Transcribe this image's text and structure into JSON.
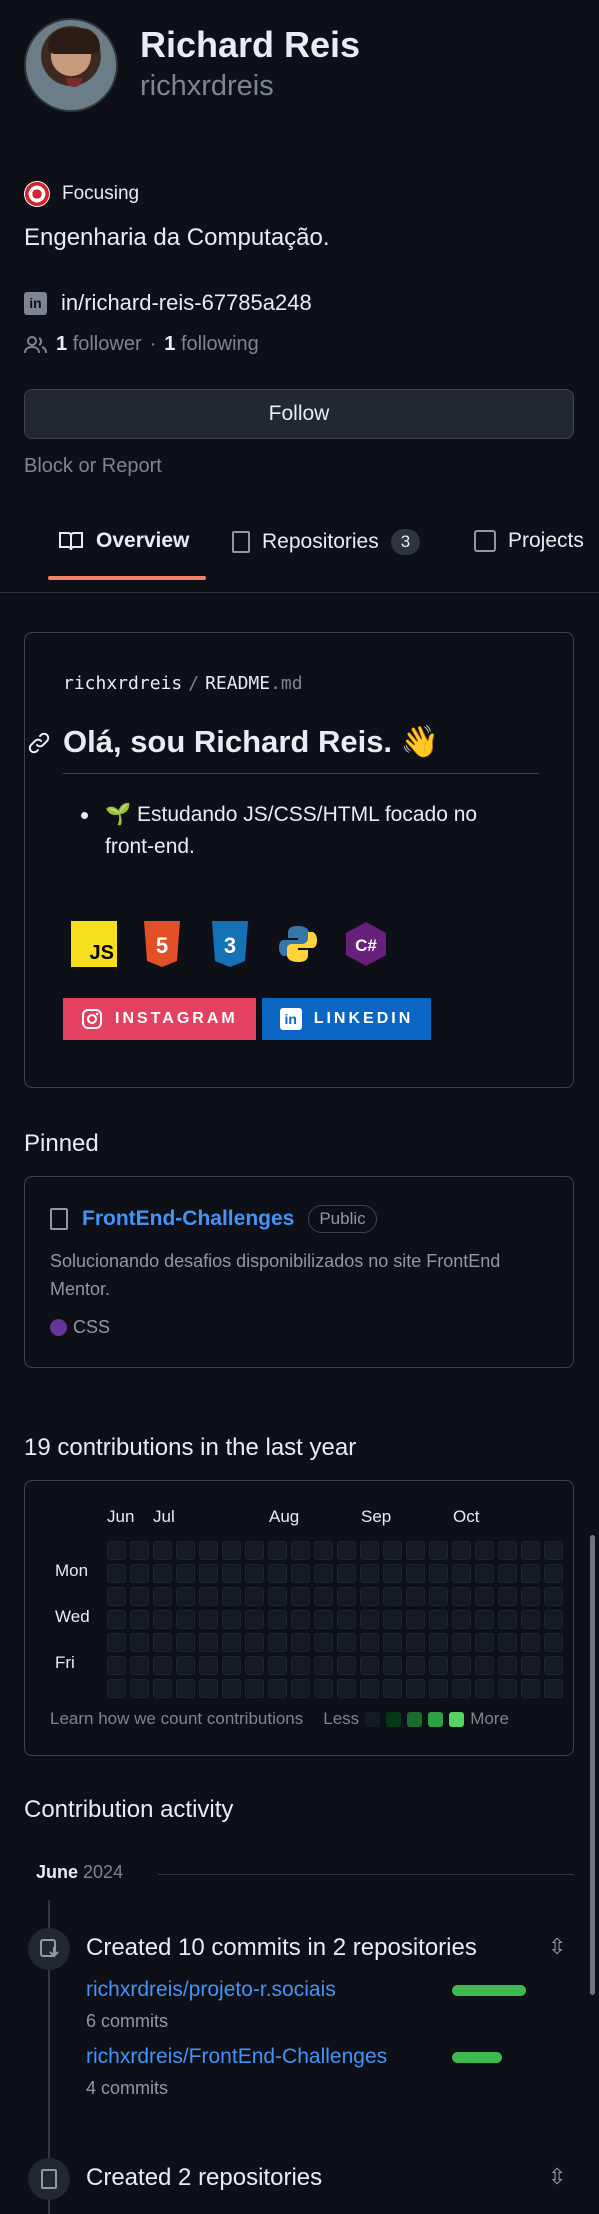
{
  "profile": {
    "name": "Richard Reis",
    "login": "richxrdreis",
    "status": "Focusing",
    "bio": "Engenharia da Computação.",
    "linkedin": "in/richard-reis-67785a248",
    "followers_count": "1",
    "followers_label": "follower",
    "separator": "·",
    "following_count": "1",
    "following_label": "following",
    "follow_button": "Follow",
    "block_report": "Block or Report"
  },
  "tabs": [
    {
      "label": "Overview",
      "active": true,
      "icon": "book-icon"
    },
    {
      "label": "Repositories",
      "count": "3",
      "icon": "repo-icon"
    },
    {
      "label": "Projects",
      "icon": "table-icon"
    }
  ],
  "readme": {
    "owner": "richxrdreis",
    "slash": "/",
    "file": "README",
    "ext": ".md",
    "heading": "Olá, sou Richard Reis. 👋",
    "bullet_emoji": "🌱",
    "bullet": "Estudando JS/CSS/HTML focado no front-end.",
    "tech_icons": [
      {
        "name": "javascript-icon",
        "label": "JS",
        "color": "#f7df1e"
      },
      {
        "name": "html5-icon",
        "label": "5",
        "color": "#e34f26"
      },
      {
        "name": "css3-icon",
        "label": "3",
        "color": "#1572b6"
      },
      {
        "name": "python-icon",
        "label": "",
        "color": "#3776ab"
      },
      {
        "name": "csharp-icon",
        "label": "C#",
        "color": "#68217a"
      }
    ],
    "badges": [
      {
        "label": "INSTAGRAM",
        "color": "#e4405f",
        "icon": "instagram-icon"
      },
      {
        "label": "LINKEDIN",
        "color": "#0a66c2",
        "icon": "linkedin-icon"
      }
    ]
  },
  "pinned": {
    "title": "Pinned",
    "repo": "FrontEnd-Challenges",
    "visibility": "Public",
    "description": "Solucionando desafios disponibilizados no site FrontEnd Mentor.",
    "language": "CSS",
    "language_color": "#663399"
  },
  "contributions": {
    "title": "19 contributions in the last year",
    "months": [
      "Jun",
      "Jul",
      "Aug",
      "Sep",
      "Oct"
    ],
    "days": [
      "Mon",
      "Wed",
      "Fri"
    ],
    "learn": "Learn how we count contributions",
    "less": "Less",
    "more": "More",
    "legend_colors": [
      "#151b23",
      "#033a16",
      "#196c2e",
      "#2ea043",
      "#56d364"
    ]
  },
  "activity": {
    "title": "Contribution activity",
    "period_month": "June",
    "period_year": "2024",
    "events": [
      {
        "title": "Created 10 commits in 2 repositories",
        "repos": [
          {
            "name": "richxrdreis/projeto-r.sociais",
            "commits": "6 commits",
            "share": 0.6
          },
          {
            "name": "richxrdreis/FrontEnd-Challenges",
            "commits": "4 commits",
            "share": 0.4
          }
        ]
      },
      {
        "title": "Created 2 repositories"
      }
    ]
  }
}
